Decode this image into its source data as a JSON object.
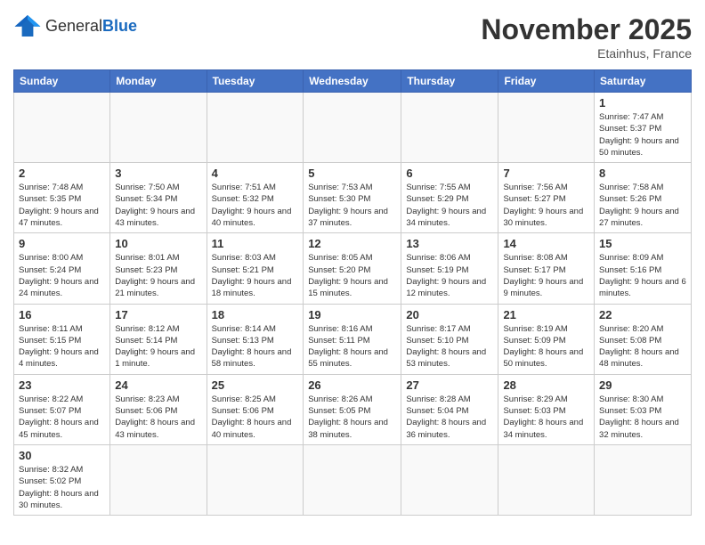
{
  "header": {
    "logo_general": "General",
    "logo_blue": "Blue",
    "month_title": "November 2025",
    "location": "Etainhus, France"
  },
  "days_of_week": [
    "Sunday",
    "Monday",
    "Tuesday",
    "Wednesday",
    "Thursday",
    "Friday",
    "Saturday"
  ],
  "weeks": [
    [
      {
        "day": "",
        "info": ""
      },
      {
        "day": "",
        "info": ""
      },
      {
        "day": "",
        "info": ""
      },
      {
        "day": "",
        "info": ""
      },
      {
        "day": "",
        "info": ""
      },
      {
        "day": "",
        "info": ""
      },
      {
        "day": "1",
        "info": "Sunrise: 7:47 AM\nSunset: 5:37 PM\nDaylight: 9 hours and 50 minutes."
      }
    ],
    [
      {
        "day": "2",
        "info": "Sunrise: 7:48 AM\nSunset: 5:35 PM\nDaylight: 9 hours and 47 minutes."
      },
      {
        "day": "3",
        "info": "Sunrise: 7:50 AM\nSunset: 5:34 PM\nDaylight: 9 hours and 43 minutes."
      },
      {
        "day": "4",
        "info": "Sunrise: 7:51 AM\nSunset: 5:32 PM\nDaylight: 9 hours and 40 minutes."
      },
      {
        "day": "5",
        "info": "Sunrise: 7:53 AM\nSunset: 5:30 PM\nDaylight: 9 hours and 37 minutes."
      },
      {
        "day": "6",
        "info": "Sunrise: 7:55 AM\nSunset: 5:29 PM\nDaylight: 9 hours and 34 minutes."
      },
      {
        "day": "7",
        "info": "Sunrise: 7:56 AM\nSunset: 5:27 PM\nDaylight: 9 hours and 30 minutes."
      },
      {
        "day": "8",
        "info": "Sunrise: 7:58 AM\nSunset: 5:26 PM\nDaylight: 9 hours and 27 minutes."
      }
    ],
    [
      {
        "day": "9",
        "info": "Sunrise: 8:00 AM\nSunset: 5:24 PM\nDaylight: 9 hours and 24 minutes."
      },
      {
        "day": "10",
        "info": "Sunrise: 8:01 AM\nSunset: 5:23 PM\nDaylight: 9 hours and 21 minutes."
      },
      {
        "day": "11",
        "info": "Sunrise: 8:03 AM\nSunset: 5:21 PM\nDaylight: 9 hours and 18 minutes."
      },
      {
        "day": "12",
        "info": "Sunrise: 8:05 AM\nSunset: 5:20 PM\nDaylight: 9 hours and 15 minutes."
      },
      {
        "day": "13",
        "info": "Sunrise: 8:06 AM\nSunset: 5:19 PM\nDaylight: 9 hours and 12 minutes."
      },
      {
        "day": "14",
        "info": "Sunrise: 8:08 AM\nSunset: 5:17 PM\nDaylight: 9 hours and 9 minutes."
      },
      {
        "day": "15",
        "info": "Sunrise: 8:09 AM\nSunset: 5:16 PM\nDaylight: 9 hours and 6 minutes."
      }
    ],
    [
      {
        "day": "16",
        "info": "Sunrise: 8:11 AM\nSunset: 5:15 PM\nDaylight: 9 hours and 4 minutes."
      },
      {
        "day": "17",
        "info": "Sunrise: 8:12 AM\nSunset: 5:14 PM\nDaylight: 9 hours and 1 minute."
      },
      {
        "day": "18",
        "info": "Sunrise: 8:14 AM\nSunset: 5:13 PM\nDaylight: 8 hours and 58 minutes."
      },
      {
        "day": "19",
        "info": "Sunrise: 8:16 AM\nSunset: 5:11 PM\nDaylight: 8 hours and 55 minutes."
      },
      {
        "day": "20",
        "info": "Sunrise: 8:17 AM\nSunset: 5:10 PM\nDaylight: 8 hours and 53 minutes."
      },
      {
        "day": "21",
        "info": "Sunrise: 8:19 AM\nSunset: 5:09 PM\nDaylight: 8 hours and 50 minutes."
      },
      {
        "day": "22",
        "info": "Sunrise: 8:20 AM\nSunset: 5:08 PM\nDaylight: 8 hours and 48 minutes."
      }
    ],
    [
      {
        "day": "23",
        "info": "Sunrise: 8:22 AM\nSunset: 5:07 PM\nDaylight: 8 hours and 45 minutes."
      },
      {
        "day": "24",
        "info": "Sunrise: 8:23 AM\nSunset: 5:06 PM\nDaylight: 8 hours and 43 minutes."
      },
      {
        "day": "25",
        "info": "Sunrise: 8:25 AM\nSunset: 5:06 PM\nDaylight: 8 hours and 40 minutes."
      },
      {
        "day": "26",
        "info": "Sunrise: 8:26 AM\nSunset: 5:05 PM\nDaylight: 8 hours and 38 minutes."
      },
      {
        "day": "27",
        "info": "Sunrise: 8:28 AM\nSunset: 5:04 PM\nDaylight: 8 hours and 36 minutes."
      },
      {
        "day": "28",
        "info": "Sunrise: 8:29 AM\nSunset: 5:03 PM\nDaylight: 8 hours and 34 minutes."
      },
      {
        "day": "29",
        "info": "Sunrise: 8:30 AM\nSunset: 5:03 PM\nDaylight: 8 hours and 32 minutes."
      }
    ],
    [
      {
        "day": "30",
        "info": "Sunrise: 8:32 AM\nSunset: 5:02 PM\nDaylight: 8 hours and 30 minutes."
      },
      {
        "day": "",
        "info": ""
      },
      {
        "day": "",
        "info": ""
      },
      {
        "day": "",
        "info": ""
      },
      {
        "day": "",
        "info": ""
      },
      {
        "day": "",
        "info": ""
      },
      {
        "day": "",
        "info": ""
      }
    ]
  ]
}
